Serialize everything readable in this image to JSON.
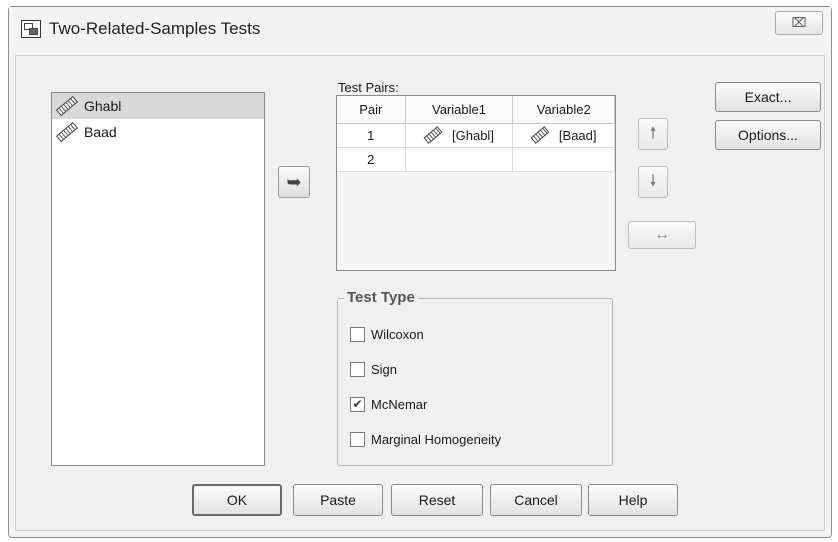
{
  "window": {
    "title": "Two-Related-Samples Tests",
    "close_glyph": "⌧"
  },
  "source_list": {
    "items": [
      {
        "label": "Ghabl",
        "icon": "scale-ruler-icon",
        "selected": true
      },
      {
        "label": "Baad",
        "icon": "scale-ruler-icon",
        "selected": false
      }
    ]
  },
  "move_button": {
    "glyph": "➥"
  },
  "test_pairs": {
    "label": "Test Pairs:",
    "columns": [
      "Pair",
      "Variable1",
      "Variable2"
    ],
    "rows": [
      {
        "pair": "1",
        "var1": "[Ghabl]",
        "var2": "[Baad]"
      },
      {
        "pair": "2",
        "var1": "",
        "var2": ""
      }
    ]
  },
  "arrows": {
    "up": "🠕",
    "down": "🠗",
    "swap": "↔"
  },
  "side_buttons": {
    "exact": "Exact...",
    "options": "Options..."
  },
  "test_type": {
    "legend": "Test Type",
    "options": [
      {
        "label": "Wilcoxon",
        "checked": false
      },
      {
        "label": "Sign",
        "checked": false
      },
      {
        "label": "McNemar",
        "checked": true
      },
      {
        "label": "Marginal Homogeneity",
        "checked": false
      }
    ]
  },
  "buttons": {
    "ok": "OK",
    "paste": "Paste",
    "reset": "Reset",
    "cancel": "Cancel",
    "help": "Help"
  },
  "colors": {
    "window_bg": "#f0f0f0",
    "selected_row": "#d9d9d9"
  }
}
